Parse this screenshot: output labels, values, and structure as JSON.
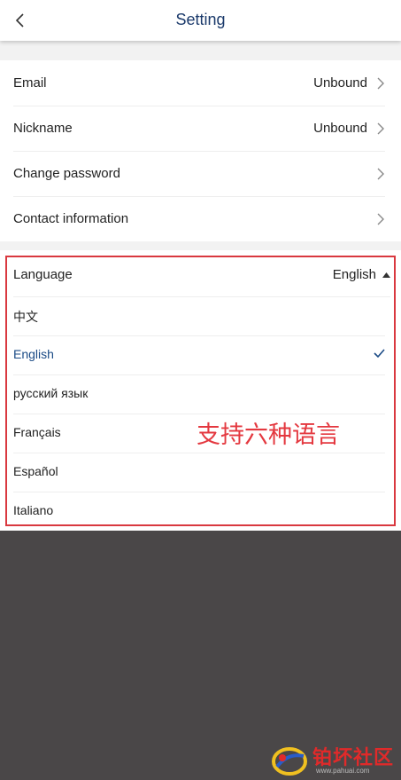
{
  "header": {
    "title": "Setting",
    "back_icon": "chevron-left-icon"
  },
  "account": {
    "items": [
      {
        "label": "Email",
        "value": "Unbound"
      },
      {
        "label": "Nickname",
        "value": "Unbound"
      },
      {
        "label": "Change password",
        "value": ""
      },
      {
        "label": "Contact information",
        "value": ""
      }
    ]
  },
  "language": {
    "label": "Language",
    "current": "English",
    "options": [
      {
        "label": "中文",
        "selected": false
      },
      {
        "label": "English",
        "selected": true
      },
      {
        "label": "русский язык",
        "selected": false
      },
      {
        "label": "Français",
        "selected": false
      },
      {
        "label": "Español",
        "selected": false
      },
      {
        "label": "Italiano",
        "selected": false
      }
    ]
  },
  "annotation": "支持六种语言",
  "watermark": {
    "text": "铂坏社区",
    "url": "www.pahuai.com"
  },
  "colors": {
    "title": "#1b3a6b",
    "selected": "#1b4b86",
    "highlight": "#d9383f",
    "overlay": "#4a4748"
  }
}
